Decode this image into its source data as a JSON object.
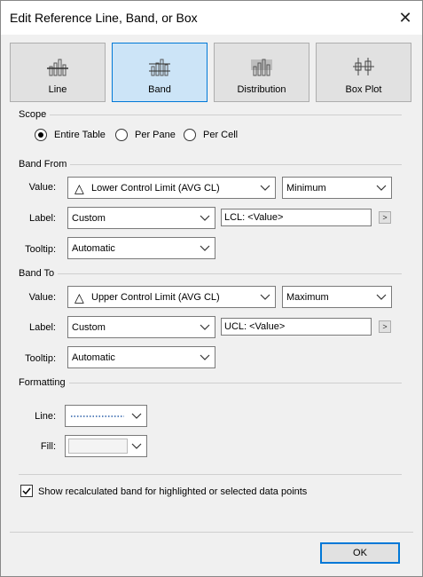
{
  "dialog": {
    "title": "Edit Reference Line, Band, or Box",
    "close_glyph": "✕"
  },
  "types": {
    "line": "Line",
    "band": "Band",
    "distribution": "Distribution",
    "box_plot": "Box Plot"
  },
  "scope": {
    "heading": "Scope",
    "entire_table": "Entire Table",
    "per_pane": "Per Pane",
    "per_cell": "Per Cell",
    "selected": "Entire Table"
  },
  "band_from": {
    "heading": "Band From",
    "value_label": "Value:",
    "value": "Lower Control Limit (AVG CL)",
    "aggregation": "Minimum",
    "label_label": "Label:",
    "label_type": "Custom",
    "label_text": "LCL: <Value>",
    "tooltip_label": "Tooltip:",
    "tooltip": "Automatic"
  },
  "band_to": {
    "heading": "Band To",
    "value_label": "Value:",
    "value": "Upper Control Limit (AVG CL)",
    "aggregation": "Maximum",
    "label_label": "Label:",
    "label_type": "Custom",
    "label_text": "UCL: <Value>",
    "tooltip_label": "Tooltip:",
    "tooltip": "Automatic"
  },
  "formatting": {
    "heading": "Formatting",
    "line_label": "Line:",
    "fill_label": "Fill:"
  },
  "options": {
    "show_recalculated": "Show recalculated band for highlighted or selected data points",
    "show_recalculated_checked": true
  },
  "footer": {
    "ok": "OK"
  },
  "icons": {
    "triangle": "△",
    "arrow_glyph": ">"
  }
}
